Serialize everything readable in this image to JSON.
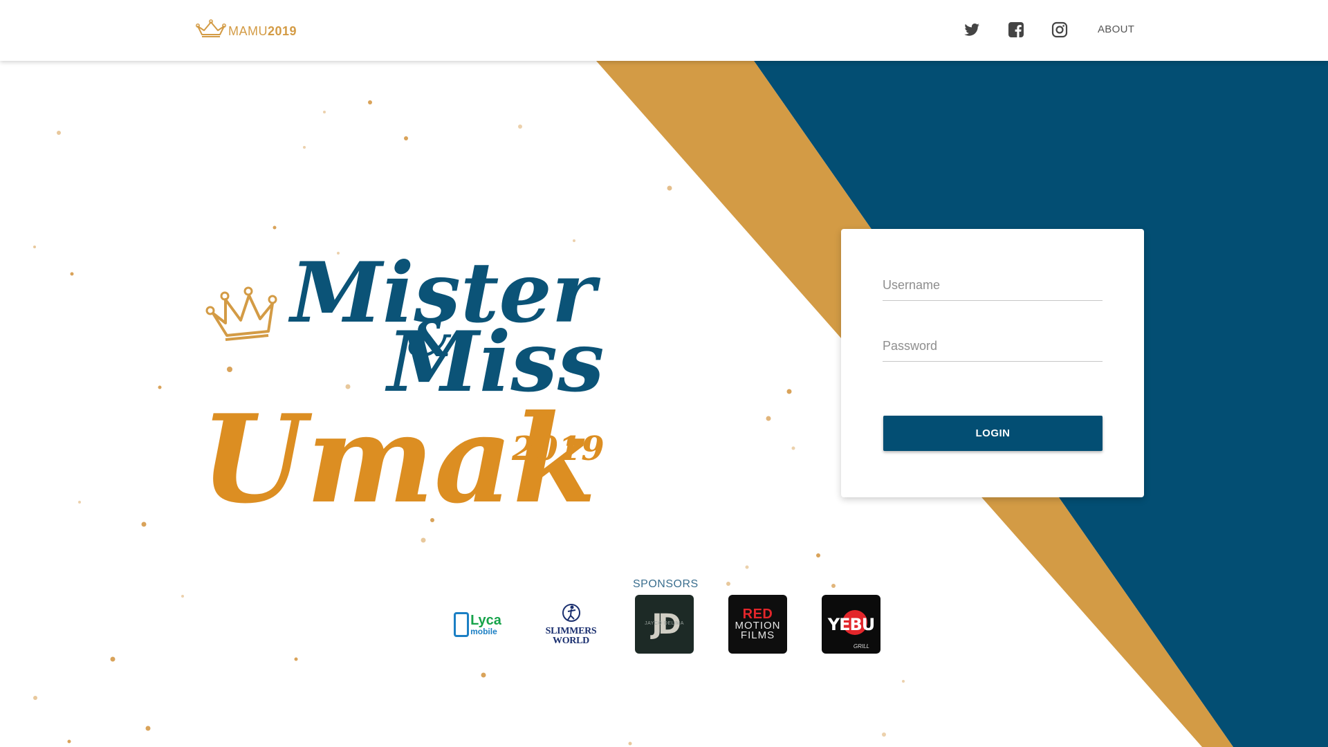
{
  "header": {
    "brand": {
      "part1": "MAMU",
      "part2": "2019"
    },
    "nav": {
      "twitter_icon": "twitter-icon",
      "facebook_icon": "facebook-icon",
      "instagram_icon": "instagram-icon",
      "about_label": "ABOUT"
    }
  },
  "hero": {
    "line1": "Mister",
    "amp": "&",
    "line2": "Miss",
    "line3": "Umak",
    "year": "2019"
  },
  "login": {
    "username_placeholder": "Username",
    "password_placeholder": "Password",
    "button_label": "LOGIN"
  },
  "sponsors": {
    "title": "SPONSORS",
    "items": [
      {
        "t1": "Lyca",
        "t2": "mobile"
      },
      {
        "t1": "SLIMMERS",
        "t2": "WORLD"
      },
      {
        "t1": "JD",
        "t2": "JAYCO DELIMA"
      },
      {
        "t1": "RED",
        "t2": "MOTION",
        "t3": "FILMS"
      },
      {
        "t1": "YEBU",
        "t2": "GRILL"
      }
    ]
  },
  "colors": {
    "navy": "#034e73",
    "gold": "#d39b45",
    "orange": "#dc8e22",
    "white": "#ffffff"
  }
}
